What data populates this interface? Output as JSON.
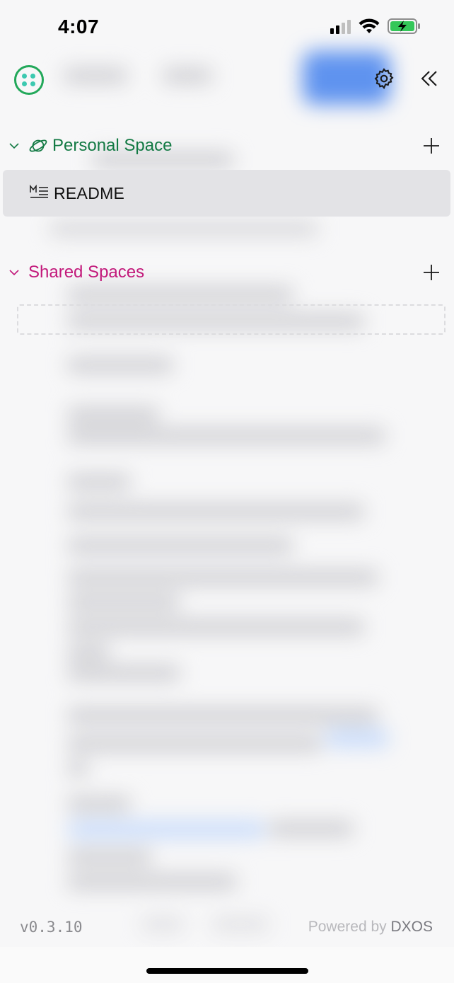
{
  "status_bar": {
    "time": "4:07"
  },
  "header": {
    "logo_icon": "dxos-logo-icon",
    "settings_icon": "gear-icon",
    "collapse_icon": "double-chevron-left-icon"
  },
  "personal_space": {
    "title": "Personal Space",
    "icon": "planet-icon",
    "add_icon": "plus-icon",
    "color": "#137a44",
    "items": [
      {
        "label": "README",
        "icon": "markdown-icon",
        "selected": true
      }
    ]
  },
  "shared_spaces": {
    "title": "Shared Spaces",
    "add_icon": "plus-icon",
    "color": "#c2187a"
  },
  "footer": {
    "version": "v0.3.10",
    "powered_prefix": "Powered by",
    "powered_brand": "DXOS"
  },
  "colors": {
    "accent_green": "#22a85a",
    "selected_bg": "#e3e3e6"
  }
}
